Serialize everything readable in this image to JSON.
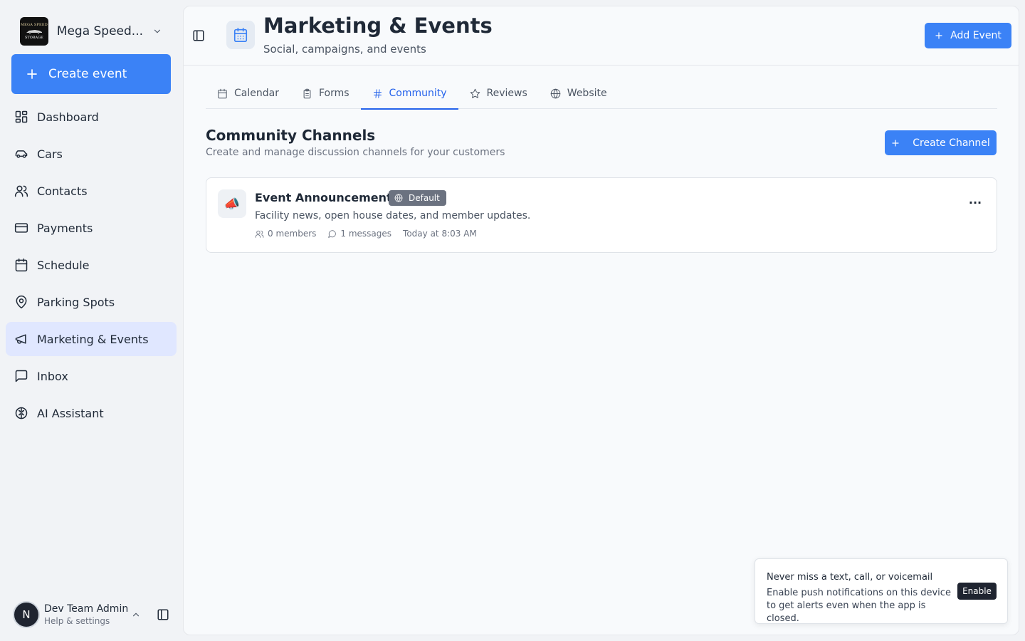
{
  "org": {
    "name": "Mega Speed...",
    "logo_line1": "MEGA SPEED",
    "logo_line2": "STORAGE"
  },
  "sidebar": {
    "create_label": "Create event",
    "items": [
      {
        "label": "Dashboard",
        "icon": "dashboard-icon"
      },
      {
        "label": "Cars",
        "icon": "car-icon"
      },
      {
        "label": "Contacts",
        "icon": "contacts-icon"
      },
      {
        "label": "Payments",
        "icon": "credit-card-icon"
      },
      {
        "label": "Schedule",
        "icon": "calendar-icon"
      },
      {
        "label": "Parking Spots",
        "icon": "map-pin-icon"
      },
      {
        "label": "Marketing & Events",
        "icon": "megaphone-icon",
        "active": true
      },
      {
        "label": "Inbox",
        "icon": "message-square-icon"
      },
      {
        "label": "AI Assistant",
        "icon": "brain-icon"
      }
    ]
  },
  "user": {
    "initial": "N",
    "name": "Dev Team Admin",
    "subtitle": "Help & settings"
  },
  "header": {
    "title": "Marketing & Events",
    "subtitle": "Social, campaigns, and events",
    "add_label": "Add Event"
  },
  "tabs": [
    {
      "label": "Calendar",
      "icon": "calendar-icon"
    },
    {
      "label": "Forms",
      "icon": "clipboard-icon"
    },
    {
      "label": "Community",
      "icon": "hash-icon",
      "active": true
    },
    {
      "label": "Reviews",
      "icon": "star-icon"
    },
    {
      "label": "Website",
      "icon": "globe-icon"
    }
  ],
  "section": {
    "title": "Community Channels",
    "subtitle": "Create and manage discussion channels for your customers",
    "create_label": "Create Channel"
  },
  "channels": [
    {
      "emoji": "📣",
      "name": "Event Announcements",
      "badge": "Default",
      "description": "Facility news, open house dates, and member updates.",
      "members": "0 members",
      "messages": "1 messages",
      "time": "Today at 8:03 AM",
      "more": "..."
    }
  ],
  "toast": {
    "title": "Never miss a text, call, or voicemail",
    "body": "Enable push notifications on this device to get alerts even when the app is closed.",
    "button": "Enable"
  },
  "colors": {
    "accent": "#3b82f6",
    "active_nav_bg": "#e0e7ff",
    "active_tab": "#2563eb",
    "badge_bg": "#6b7280"
  }
}
